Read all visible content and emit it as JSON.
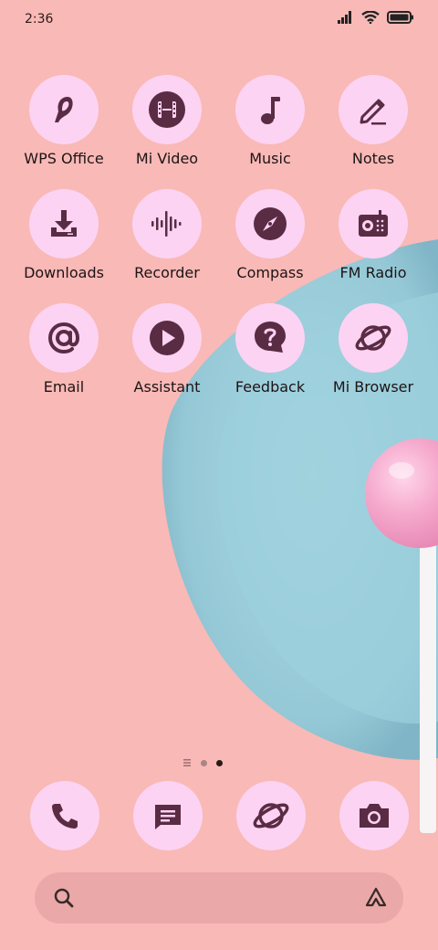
{
  "status": {
    "time": "2:36",
    "icons": [
      "signal-icon",
      "wifi-icon",
      "battery-icon"
    ]
  },
  "apps": [
    {
      "label": "WPS Office",
      "icon": "wps-office-icon"
    },
    {
      "label": "Mi Video",
      "icon": "film-icon"
    },
    {
      "label": "Music",
      "icon": "music-note-icon"
    },
    {
      "label": "Notes",
      "icon": "pencil-icon"
    },
    {
      "label": "Downloads",
      "icon": "download-icon"
    },
    {
      "label": "Recorder",
      "icon": "waveform-icon"
    },
    {
      "label": "Compass",
      "icon": "compass-icon"
    },
    {
      "label": "FM Radio",
      "icon": "radio-icon"
    },
    {
      "label": "Email",
      "icon": "at-sign-icon"
    },
    {
      "label": "Assistant",
      "icon": "play-icon"
    },
    {
      "label": "Feedback",
      "icon": "question-bubble-icon"
    },
    {
      "label": "Mi Browser",
      "icon": "planet-icon"
    }
  ],
  "dock": [
    {
      "icon": "phone-icon"
    },
    {
      "icon": "message-icon"
    },
    {
      "icon": "planet-icon"
    },
    {
      "icon": "camera-icon"
    }
  ],
  "page_indicator": {
    "pages": 3,
    "current": 3
  },
  "search": {
    "icons": [
      "search-icon",
      "assistant-icon"
    ]
  },
  "colors": {
    "background": "#f9b9b6",
    "icon_bg": "#fdd3f3",
    "icon_fg": "#5a2c44",
    "plate": "#9bcbd8",
    "lollipop": "#f4a9cc"
  }
}
